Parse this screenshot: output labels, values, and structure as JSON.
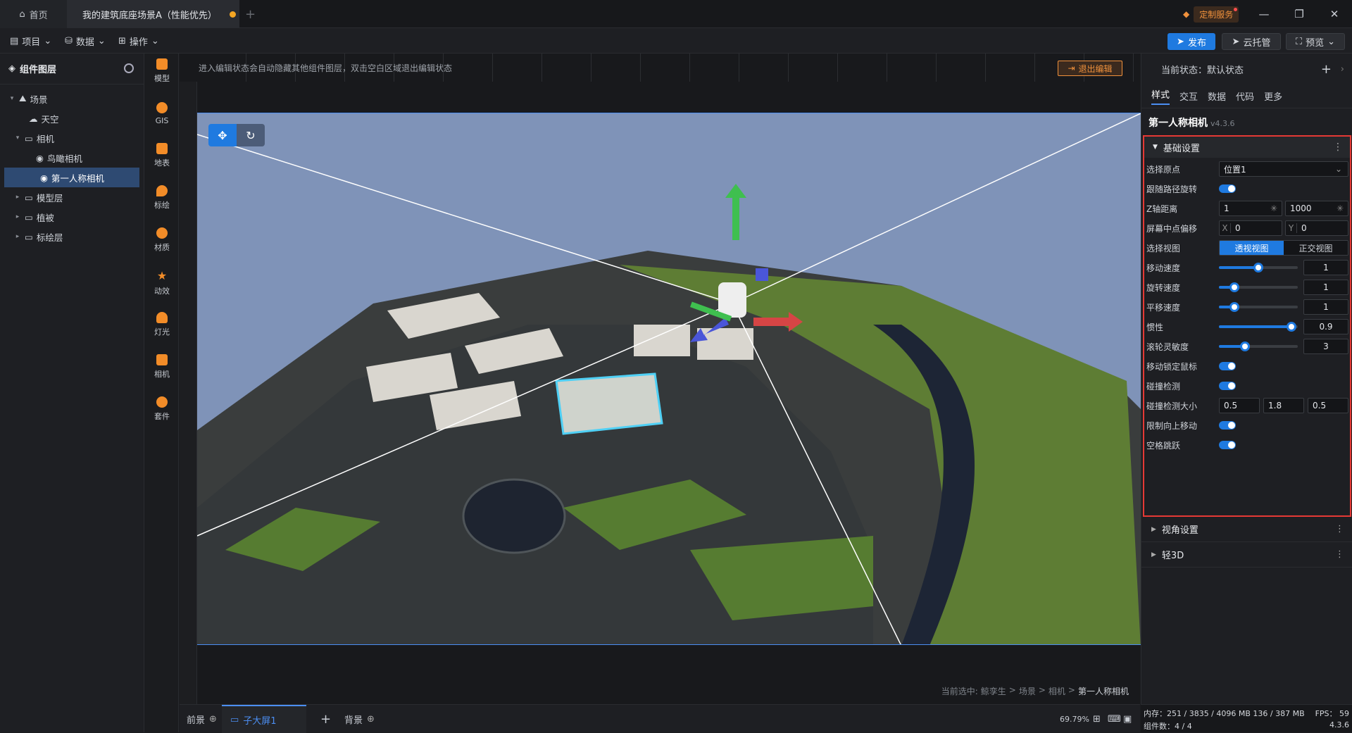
{
  "titlebar": {
    "home_tab": "首页",
    "scene_tab": "我的建筑底座场景A（性能优先）",
    "custom_service": "定制服务"
  },
  "toolbar": {
    "menu_project": "项目",
    "menu_data": "数据",
    "menu_operate": "操作",
    "publish": "发布",
    "cloud": "云托管",
    "preview": "预览"
  },
  "layers": {
    "title": "组件图层",
    "items": [
      {
        "label": "场景",
        "caret": "▾"
      },
      {
        "label": "天空",
        "caret": ""
      },
      {
        "label": "相机",
        "caret": "▾"
      },
      {
        "label": "鸟瞰相机",
        "caret": ""
      },
      {
        "label": "第一人称相机",
        "caret": ""
      },
      {
        "label": "模型层",
        "caret": "▸"
      },
      {
        "label": "植被",
        "caret": "▸"
      },
      {
        "label": "标绘层",
        "caret": "▸"
      }
    ]
  },
  "iconbar": [
    "模型",
    "GIS",
    "地表",
    "标绘",
    "材质",
    "动效",
    "灯光",
    "相机",
    "套件"
  ],
  "canvas": {
    "hint": "进入编辑状态会自动隐藏其他组件图层，双击空白区域退出编辑状态",
    "exit_edit": "退出编辑",
    "breadcrumb": [
      "当前选中:",
      "鲸孪生",
      "场景",
      "相机",
      "第一人称相机"
    ],
    "bottom_front": "前景",
    "bottom_sub": "子大屏1",
    "bottom_back": "背景",
    "zoom": "69.79%"
  },
  "props": {
    "state": "当前状态：默认状态",
    "tabs": [
      "样式",
      "交互",
      "数据",
      "代码",
      "更多"
    ],
    "component": "第一人称相机",
    "version": "v4.3.6",
    "basic_section": "基础设置",
    "labels": {
      "origin": "选择原点",
      "follow_rotate": "跟随路径旋转",
      "z_distance": "Z轴距离",
      "center_offset": "屏幕中点偏移",
      "view": "选择视图",
      "move_speed": "移动速度",
      "rotate_speed": "旋转速度",
      "pan_speed": "平移速度",
      "inertia": "惯性",
      "wheel": "滚轮灵敏度",
      "lock_mouse": "移动锁定鼠标",
      "collision": "碰撞检测",
      "collision_size": "碰撞检测大小",
      "limit_up": "限制向上移动",
      "space_jump": "空格跳跃"
    },
    "origin_value": "位置1",
    "z_min": "1",
    "z_max": "1000",
    "offset_x_label": "X",
    "offset_x": "0",
    "offset_y_label": "Y",
    "offset_y": "0",
    "view_persp": "透视视图",
    "view_ortho": "正交视图",
    "move_speed": "1",
    "rotate_speed": "1",
    "pan_speed": "1",
    "inertia": "0.9",
    "wheel": "3",
    "size_a": "0.5",
    "size_b": "1.8",
    "size_c": "0.5",
    "sliders": {
      "move": 0.5,
      "rotate": 0.2,
      "pan": 0.2,
      "inertia": 0.92,
      "wheel": 0.33
    },
    "view_section": "视角设置",
    "light3d_section": "轻3D"
  },
  "status": {
    "memory": "内存：251 / 3835 / 4096 MB  136 / 387 MB",
    "fps": "FPS： 59",
    "components": "组件数：4 / 4",
    "version": "4.3.6"
  },
  "colors": {
    "accent": "#1f7ae0",
    "warn": "#f0913c",
    "highlight": "#e53935"
  }
}
